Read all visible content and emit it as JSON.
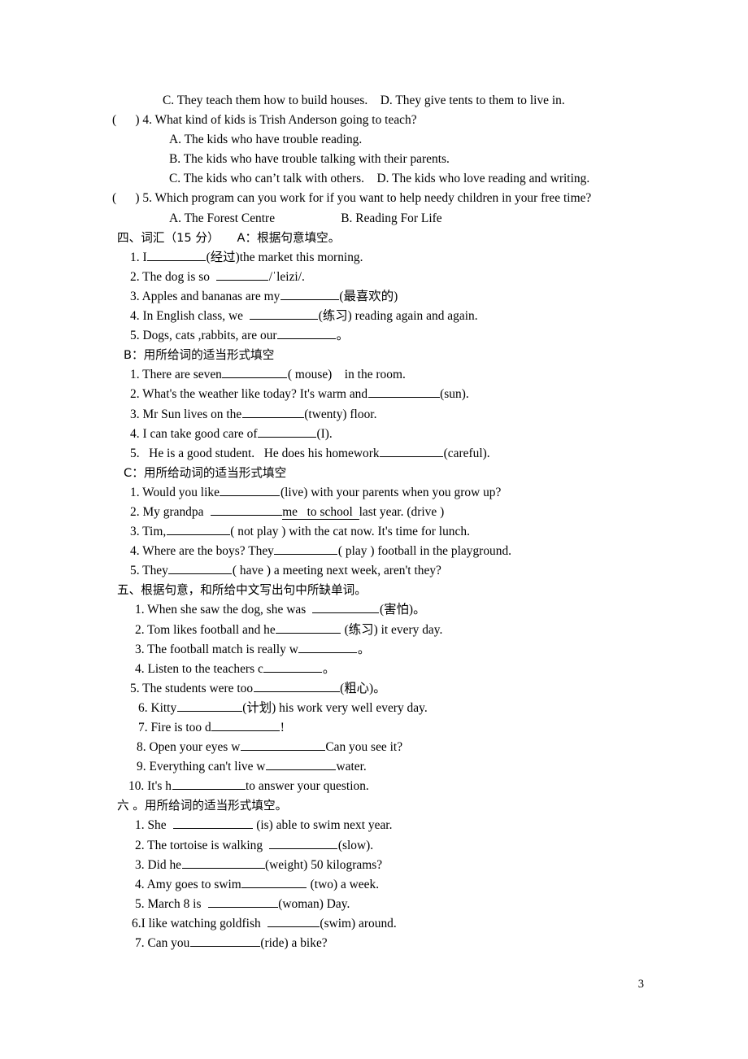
{
  "page": {
    "number": "3",
    "background": "#ffffff",
    "text_color": "#000000"
  },
  "reading_tail": {
    "q3_options_cd": "C. They teach them how to build houses.    D. They give tents to them to live in.",
    "q4_stem": "(      ) 4. What kind of kids is Trish Anderson going to teach?",
    "q4_a": "A. The kids who have trouble reading.",
    "q4_b": "B. The kids who have trouble talking with their parents.",
    "q4_cd": "C. The kids who can’t talk with others.    D. The kids who love reading and writing.",
    "q5_stem": "(      ) 5. Which program can you work for if you want to help needy children in your free time?",
    "q5_ab": "A. The Forest Centre                     B. Reading For Life"
  },
  "section_four": {
    "heading": "四、词汇（15 分）　　A：根据句意填空。",
    "part_a": [
      {
        "pre": "1. I",
        "blank": 72,
        "post": "(经过)the market this morning."
      },
      {
        "pre": "2. The dog is so  ",
        "blank": 64,
        "post": "/ˈleizi/."
      },
      {
        "pre": "3. Apples and bananas are my",
        "blank": 72,
        "post": "(最喜欢的)"
      },
      {
        "pre": "4. In English class, we  ",
        "blank": 84,
        "post": "(练习) reading again and again."
      },
      {
        "pre": "5. Dogs, cats ,rabbits, are our",
        "blank": 72,
        "post": "。"
      }
    ],
    "part_b_heading": "B：用所给词的适当形式填空",
    "part_b": [
      {
        "pre": "1. There are seven",
        "blank": 80,
        "post": "( mouse)    in the room."
      },
      {
        "pre": "2. What's the weather like today? It's warm and",
        "blank": 88,
        "post": "(sun)."
      },
      {
        "pre": "3. Mr Sun lives on the",
        "blank": 76,
        "post": "(twenty) floor."
      },
      {
        "pre": "4. I can take good care of",
        "blank": 72,
        "post": "(I)."
      },
      {
        "pre": "5.   He is a good student.   He does his homework",
        "blank": 78,
        "post": "(careful)."
      }
    ],
    "part_c_heading": "C：用所给动词的适当形式填空",
    "part_c": [
      {
        "pre": "1. Would you like",
        "blank": 74,
        "post": "(live) with your parents when you grow up?"
      },
      {
        "pre": "2. My grandpa  ",
        "blank": 88,
        "underlined": "me   to school  ",
        "post": "last year. (drive )"
      },
      {
        "pre": "3. Tim,",
        "blank": 78,
        "post": "( not play ) with the cat now. It's time for lunch."
      },
      {
        "pre": "4. Where are the boys? They",
        "blank": 78,
        "post": "( play ) football in the playground."
      },
      {
        "pre": "5. They",
        "blank": 78,
        "post": "( have ) a meeting next week, aren't they?"
      }
    ]
  },
  "section_five": {
    "heading": "五、根据句意，和所给中文写出句中所缺单词。",
    "items": [
      {
        "pre": "1. When she saw the dog, she was  ",
        "blank": 82,
        "post": "(害怕)。"
      },
      {
        "pre": "2. Tom likes football and he",
        "blank": 80,
        "post": " (练习) it every day."
      },
      {
        "pre": "3. The football match is really w",
        "blank": 72,
        "post": "。"
      },
      {
        "pre": "4. Listen to the teachers c",
        "blank": 72,
        "post": "。"
      },
      {
        "pre": "5. The students were too",
        "blank": 106,
        "post": "(粗心)。"
      },
      {
        "pre": "6. Kitty",
        "blank": 80,
        "post": "(计划) his work very well every day."
      },
      {
        "pre": "7. Fire is too d",
        "blank": 84,
        "post": "!"
      },
      {
        "pre": "8. Open your eyes w",
        "blank": 104,
        "post": "Can you see it?"
      },
      {
        "pre": "9. Everything can't live w",
        "blank": 86,
        "post": "water."
      },
      {
        "pre": "10. It's h",
        "blank": 90,
        "post": "to answer your question."
      }
    ]
  },
  "section_six": {
    "heading": "六 。用所给词的适当形式填空。",
    "items": [
      {
        "pre": "1. She  ",
        "blank": 98,
        "post": " (is) able to swim next year."
      },
      {
        "pre": "2. The tortoise is walking  ",
        "blank": 84,
        "post": "(slow)."
      },
      {
        "pre": "3. Did he",
        "blank": 102,
        "post": "(weight) 50 kilograms?"
      },
      {
        "pre": "4. Amy goes to swim",
        "blank": 80,
        "post": " (two) a week."
      },
      {
        "pre": "5. March 8 is  ",
        "blank": 86,
        "post": "(woman) Day."
      },
      {
        "pre": "6.I like watching goldfish  ",
        "blank": 64,
        "post": "(swim) around."
      },
      {
        "pre": "7. Can you",
        "blank": 86,
        "post": "(ride) a bike?"
      }
    ]
  }
}
